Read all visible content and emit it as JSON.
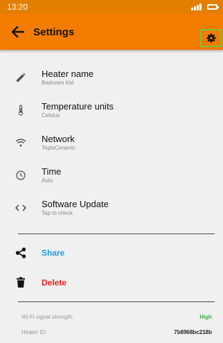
{
  "status_bar": {
    "time": "13:20"
  },
  "app_bar": {
    "title": "Settings"
  },
  "settings": [
    {
      "icon": "pencil-icon",
      "title": "Heater name",
      "subtitle": "Bedroom Kid"
    },
    {
      "icon": "thermometer-icon",
      "title": "Temperature units",
      "subtitle": "Celsius"
    },
    {
      "icon": "wifi-icon",
      "title": "Network",
      "subtitle": "TeploCeramic"
    },
    {
      "icon": "clock-icon",
      "title": "Time",
      "subtitle": "Auto"
    },
    {
      "icon": "code-icon",
      "title": "Software Update",
      "subtitle": "Tap to check"
    }
  ],
  "actions": {
    "share": {
      "label": "Share",
      "color": "#1e9be0"
    },
    "delete": {
      "label": "Delete",
      "color": "#e02020"
    }
  },
  "info": {
    "wifi_label": "Wi-Fi signal strength:",
    "wifi_value": "High",
    "wifi_color": "#3cb043",
    "heater_id_label": "Heater ID:",
    "heater_id_value": "7b8968bc218b"
  },
  "colors": {
    "app_bar": "#f47c00",
    "status_bar": "#e27f00"
  }
}
